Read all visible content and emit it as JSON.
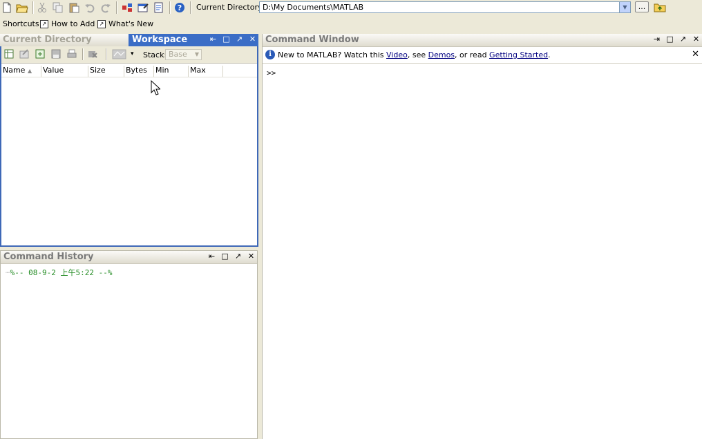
{
  "toolbar": {
    "current_directory_label": "Current Directory:",
    "current_directory_value": "D:\\My Documents\\MATLAB",
    "browse_label": "...",
    "icons": [
      "new-file-icon",
      "open-file-icon",
      "cut-icon",
      "copy-icon",
      "paste-icon",
      "undo-icon",
      "redo-icon",
      "simulink-icon",
      "guide-icon",
      "profiler-icon",
      "help-icon"
    ]
  },
  "shortcuts": {
    "label": "Shortcuts",
    "how_to_add": "How to Add",
    "whats_new": "What's New"
  },
  "workspace": {
    "tab_current_directory": "Current Directory",
    "tab_workspace": "Workspace",
    "stack_label": "Stack:",
    "stack_value": "Base",
    "columns": [
      "Name",
      "Value",
      "Size",
      "Bytes",
      "Min",
      "Max"
    ]
  },
  "history": {
    "title": "Command History",
    "entries": [
      "%-- 08-9-2 上午5:22 --%"
    ]
  },
  "command_window": {
    "title": "Command Window",
    "info_prefix": "New to MATLAB? Watch this ",
    "video_link": "Video",
    "sep1": ", see ",
    "demos_link": "Demos",
    "sep2": ", or read ",
    "getting_started_link": "Getting Started",
    "info_suffix": ".",
    "prompt": ">>"
  },
  "colors": {
    "accent": "#3b6dc6",
    "history_green": "#228b22",
    "link": "#000080"
  }
}
